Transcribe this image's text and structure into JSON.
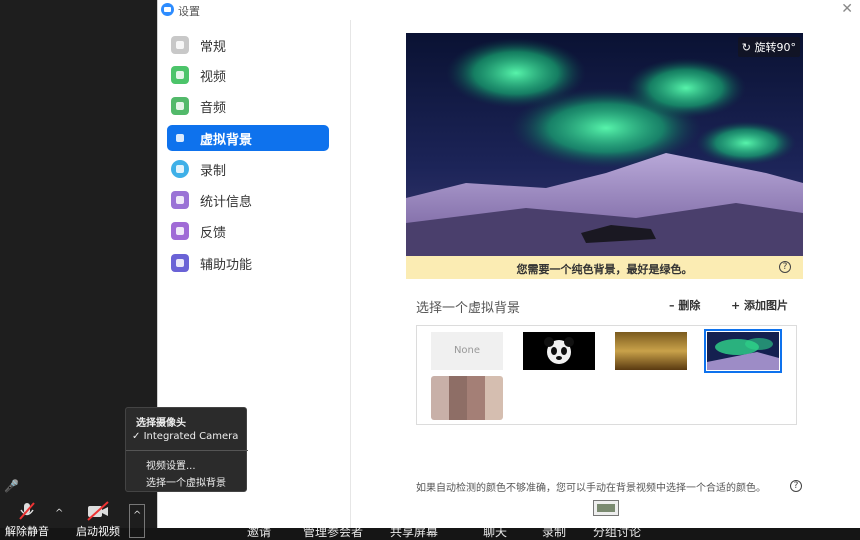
{
  "window": {
    "title": "设置",
    "close_icon": "close-icon"
  },
  "sidebar": {
    "items": [
      {
        "label": "常规",
        "icon": "gear-icon",
        "color": "#c8c8c8",
        "active": false
      },
      {
        "label": "视频",
        "icon": "video-icon",
        "color": "#4cc46a",
        "active": false
      },
      {
        "label": "音频",
        "icon": "headphones-icon",
        "color": "#52b96a",
        "active": false
      },
      {
        "label": "虚拟背景",
        "icon": "person-card-icon",
        "color": "#0e72ed",
        "active": true
      },
      {
        "label": "录制",
        "icon": "record-icon",
        "color": "#3eb0e8",
        "active": false
      },
      {
        "label": "统计信息",
        "icon": "stats-icon",
        "color": "#9a72d6",
        "active": false
      },
      {
        "label": "反馈",
        "icon": "smile-icon",
        "color": "#a06ad6",
        "active": false
      },
      {
        "label": "辅助功能",
        "icon": "accessibility-icon",
        "color": "#6a62d6",
        "active": false
      }
    ]
  },
  "preview": {
    "rotate_label": "旋转90°",
    "hint": "您需要一个纯色背景，最好是绿色。"
  },
  "backgrounds": {
    "label": "选择一个虚拟背景",
    "delete_label": "删除",
    "add_label": "添加图片",
    "none_label": "None"
  },
  "bottom_hint": "如果自动检测的颜色不够准确，您可以手动在背景视频中选择一个合适的颜色。",
  "camera_menu": {
    "title": "选择摄像头",
    "camera": "Integrated Camera",
    "check": "✓",
    "video_settings": "视频设置...",
    "choose_background": "选择一个虚拟背景"
  },
  "toolbar": {
    "unmute": "解除静音",
    "start_video": "启动视频",
    "hidden_labels": [
      "邀请",
      "管理参会者",
      "共享屏幕",
      "聊天",
      "录制",
      "分组讨论"
    ]
  },
  "colors": {
    "accent": "#0e72ed",
    "hint_bg": "#fbecb3"
  }
}
